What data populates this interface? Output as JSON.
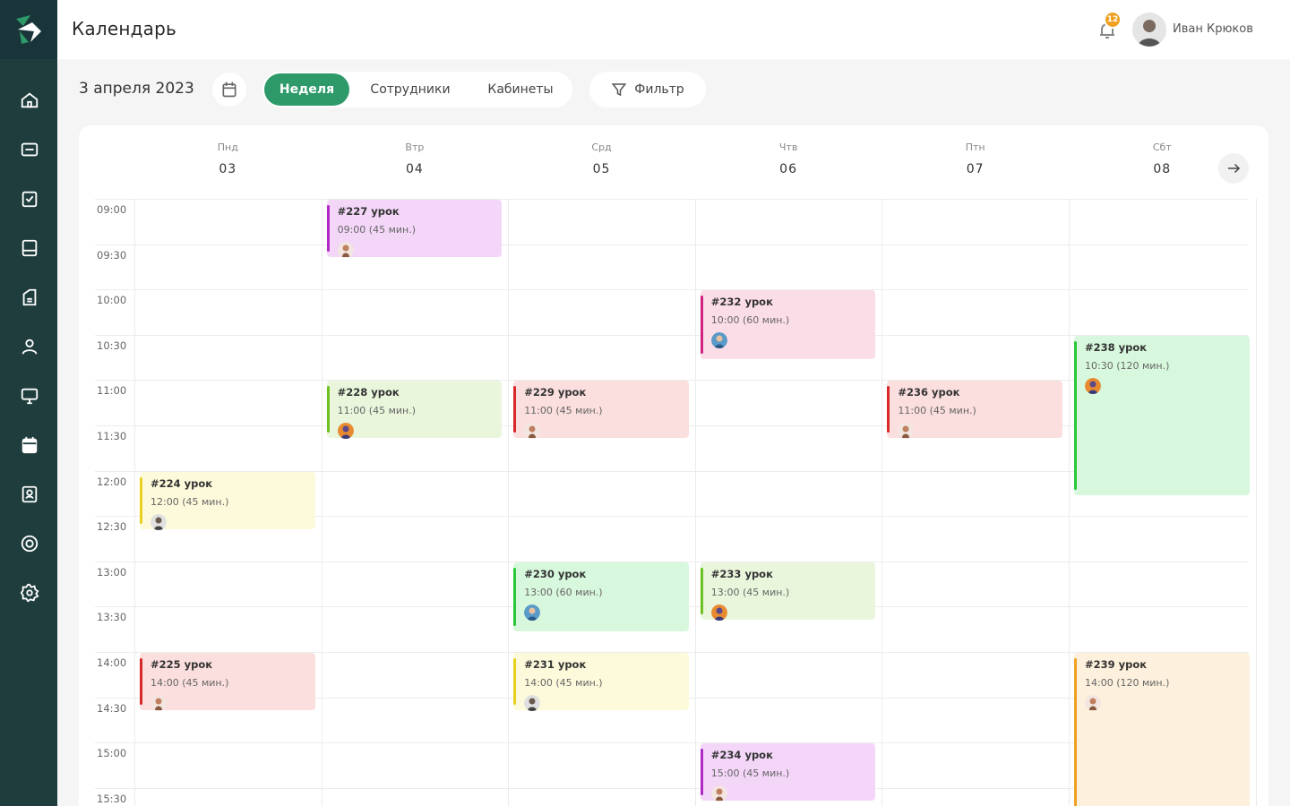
{
  "topbar": {
    "title": "Календарь",
    "notifications": "12",
    "user_name": "Иван Крюков"
  },
  "controls": {
    "date": "3 апреля 2023",
    "view_week": "Неделя",
    "view_staff": "Сотрудники",
    "view_rooms": "Кабинеты",
    "filter": "Фильтр"
  },
  "days": [
    {
      "name": "Пнд",
      "num": "03"
    },
    {
      "name": "Втр",
      "num": "04"
    },
    {
      "name": "Срд",
      "num": "05"
    },
    {
      "name": "Чтв",
      "num": "06"
    },
    {
      "name": "Птн",
      "num": "07"
    },
    {
      "name": "Сбт",
      "num": "08"
    }
  ],
  "times": [
    "09:00",
    "09:30",
    "10:00",
    "10:30",
    "11:00",
    "11:30",
    "12:00",
    "12:30",
    "13:00",
    "13:30",
    "14:00",
    "14:30",
    "15:00",
    "15:30"
  ],
  "events": [
    {
      "title": "#227 урок",
      "time": "09:00 (45 мин.)",
      "day": 1,
      "start": "09:00",
      "duration": 45,
      "color": "#f3d6f8",
      "accent": "#b028c8",
      "avatar": "person-female-icon"
    },
    {
      "title": "#232 урок",
      "time": "10:00 (60 мин.)",
      "day": 3,
      "start": "10:00",
      "duration": 60,
      "color": "#fbdde8",
      "accent": "#d02080",
      "avatar": "person-blue-icon"
    },
    {
      "title": "#238 урок",
      "time": "10:30 (120 мин.)",
      "day": 5,
      "start": "10:30",
      "duration": 120,
      "color": "#d8f8dd",
      "accent": "#28c838",
      "avatar": "person-orange-icon"
    },
    {
      "title": "#228 урок",
      "time": "11:00 (45 мин.)",
      "day": 1,
      "start": "11:00",
      "duration": 45,
      "color": "#e9f6dc",
      "accent": "#6cc020",
      "avatar": "person-orange-icon"
    },
    {
      "title": "#229 урок",
      "time": "11:00 (45 мин.)",
      "day": 2,
      "start": "11:00",
      "duration": 45,
      "color": "#fbdede",
      "accent": "#d82828",
      "avatar": "person-female-icon"
    },
    {
      "title": "#236 урок",
      "time": "11:00 (45 мин.)",
      "day": 4,
      "start": "11:00",
      "duration": 45,
      "color": "#fbdede",
      "accent": "#d82828",
      "avatar": "person-female-icon"
    },
    {
      "title": "#224 урок",
      "time": "12:00 (45 мин.)",
      "day": 0,
      "start": "12:00",
      "duration": 45,
      "color": "#fdfadb",
      "accent": "#e8d020",
      "avatar": "person-gray-icon"
    },
    {
      "title": "#230 урок",
      "time": "13:00 (60 мин.)",
      "day": 2,
      "start": "13:00",
      "duration": 60,
      "color": "#d8f8dd",
      "accent": "#28c838",
      "avatar": "person-blue-icon"
    },
    {
      "title": "#233 урок",
      "time": "13:00 (45 мин.)",
      "day": 3,
      "start": "13:00",
      "duration": 45,
      "color": "#e9f6dc",
      "accent": "#6cc020",
      "avatar": "person-orange-icon"
    },
    {
      "title": "#225 урок",
      "time": "14:00 (45 мин.)",
      "day": 0,
      "start": "14:00",
      "duration": 45,
      "color": "#fbdede",
      "accent": "#d82828",
      "avatar": "person-female-icon"
    },
    {
      "title": "#231 урок",
      "time": "14:00 (45 мин.)",
      "day": 2,
      "start": "14:00",
      "duration": 45,
      "color": "#fdfadb",
      "accent": "#e8d020",
      "avatar": "person-gray-icon"
    },
    {
      "title": "#239 урок",
      "time": "14:00 (120 мин.)",
      "day": 5,
      "start": "14:00",
      "duration": 120,
      "color": "#fdf0dc",
      "accent": "#f0a020",
      "avatar": "person-female-icon"
    },
    {
      "title": "#234 урок",
      "time": "15:00 (45 мин.)",
      "day": 3,
      "start": "15:00",
      "duration": 45,
      "color": "#f3d6f8",
      "accent": "#b028c8",
      "avatar": "person-female-icon"
    }
  ],
  "sidebar": [
    "home-icon",
    "inbox-icon",
    "tasks-icon",
    "journal-icon",
    "reports-icon",
    "users-icon",
    "monitor-icon",
    "calendar-icon",
    "book-user-icon",
    "support-icon",
    "settings-icon"
  ],
  "colors": {
    "sidebar": "#1f3d3d",
    "accent": "#2e9a6a"
  }
}
